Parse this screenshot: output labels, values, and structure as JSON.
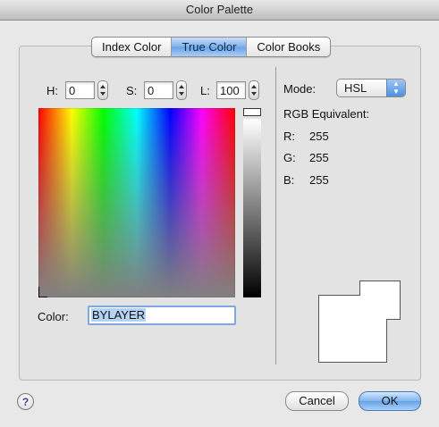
{
  "window": {
    "title": "Color Palette"
  },
  "tabs": [
    {
      "label": "Index Color",
      "active": false
    },
    {
      "label": "True Color",
      "active": true
    },
    {
      "label": "Color Books",
      "active": false
    }
  ],
  "hsl": {
    "h_label": "H:",
    "h_value": "0",
    "s_label": "S:",
    "s_value": "0",
    "l_label": "L:",
    "l_value": "100"
  },
  "color": {
    "label": "Color:",
    "value": "BYLAYER"
  },
  "mode": {
    "label": "Mode:",
    "value": "HSL"
  },
  "rgb": {
    "heading": "RGB Equivalent:",
    "r_label": "R:",
    "r_value": "255",
    "g_label": "G:",
    "g_value": "255",
    "b_label": "B:",
    "b_value": "255"
  },
  "preview": {
    "new_color": "#ffffff",
    "current_color": "#ffffff"
  },
  "buttons": {
    "help": "?",
    "cancel": "Cancel",
    "ok": "OK"
  },
  "colors": {
    "accent": "#6aa3e6",
    "selection": "#b5d3f3"
  }
}
